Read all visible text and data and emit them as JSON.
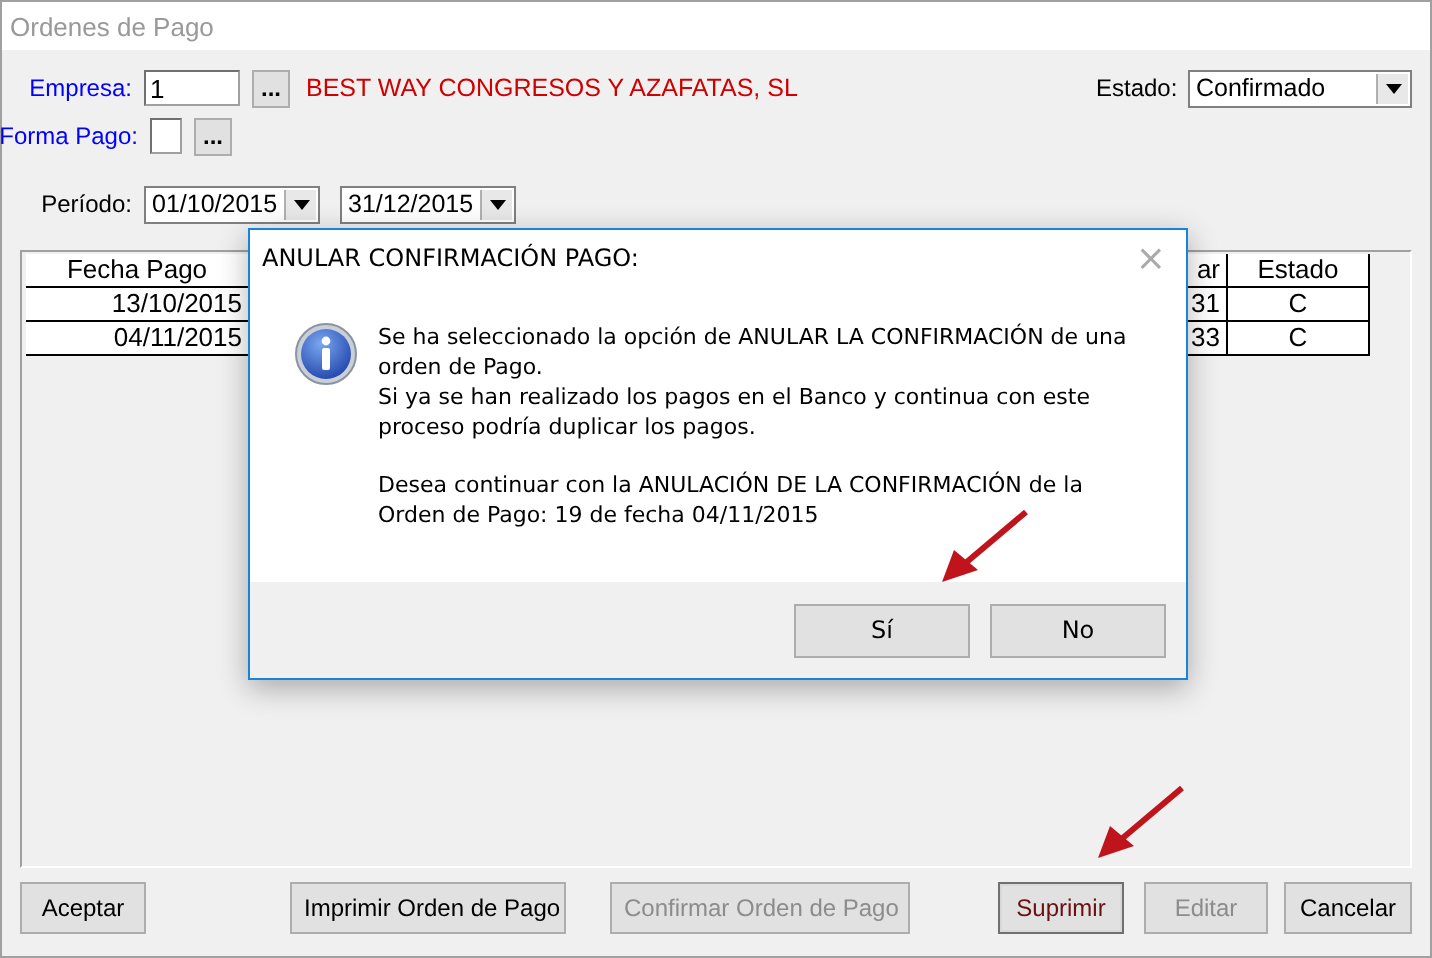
{
  "window": {
    "title": "Ordenes de Pago"
  },
  "form": {
    "empresa": {
      "label": "Empresa:",
      "value": "1",
      "lookup": "...",
      "name": "BEST WAY CONGRESOS Y AZAFATAS, SL"
    },
    "forma_pago": {
      "label": "Forma Pago:",
      "lookup": "..."
    },
    "estado": {
      "label": "Estado:",
      "value": "Confirmado"
    },
    "periodo": {
      "label": "Período:",
      "from": "01/10/2015",
      "to": "31/12/2015"
    }
  },
  "table": {
    "columns": [
      "Fecha Pago",
      "ar",
      "Estado"
    ],
    "rows": [
      [
        "13/10/2015",
        "31",
        "C"
      ],
      [
        "04/11/2015",
        "33",
        "C"
      ]
    ]
  },
  "buttons": [
    {
      "label": "Aceptar",
      "disabled": false,
      "focused": false
    },
    {
      "label": "Imprimir Orden de Pago",
      "disabled": false,
      "focused": false
    },
    {
      "label": "Confirmar Orden de Pago",
      "disabled": true,
      "focused": false
    },
    {
      "label": "Suprimir",
      "disabled": false,
      "focused": true
    },
    {
      "label": "Editar",
      "disabled": true,
      "focused": false
    },
    {
      "label": "Cancelar",
      "disabled": false,
      "focused": false
    }
  ],
  "dialog": {
    "title": "ANULAR CONFIRMACIÓN PAGO:",
    "close": "×",
    "paragraphs": [
      "Se ha seleccionado la opción de ANULAR LA CONFIRMACIÓN de una\norden de Pago.\nSi ya se han realizado los pagos en el Banco y continua con este\nproceso podría duplicar los pagos.",
      "Desea continuar con la ANULACIÓN DE LA CONFIRMACIÓN de la\nOrden de Pago: 19 de fecha 04/11/2015"
    ],
    "buttons": [
      {
        "label": "Sí"
      },
      {
        "label": "No"
      }
    ]
  }
}
